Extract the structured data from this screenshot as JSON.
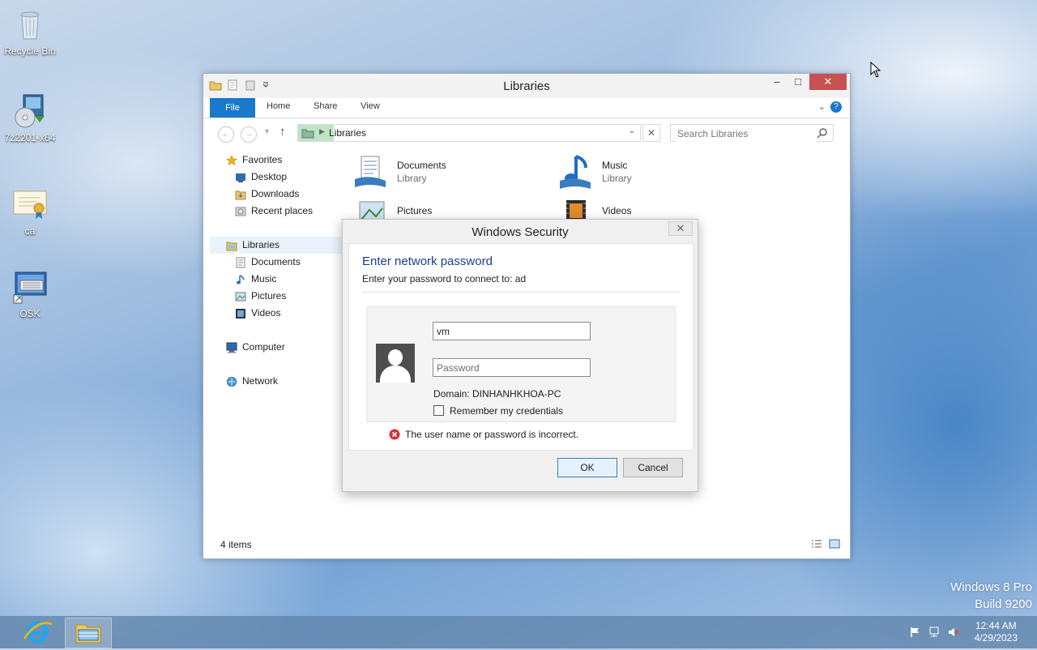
{
  "desktop": {
    "icons": [
      {
        "label": "Recycle Bin"
      },
      {
        "label": "7z2201-x64"
      },
      {
        "label": "ca"
      },
      {
        "label": "OSK"
      }
    ],
    "watermark": {
      "line1": "Windows 8 Pro",
      "line2": "Build 9200"
    }
  },
  "explorer": {
    "title": "Libraries",
    "ribbon_tabs": {
      "file": "File",
      "home": "Home",
      "share": "Share",
      "view": "View"
    },
    "address": "Libraries",
    "search_placeholder": "Search Libraries",
    "nav": {
      "favorites": "Favorites",
      "desktop": "Desktop",
      "downloads": "Downloads",
      "recent": "Recent places",
      "libraries": "Libraries",
      "documents": "Documents",
      "music": "Music",
      "pictures": "Pictures",
      "videos": "Videos",
      "computer": "Computer",
      "network": "Network"
    },
    "items": [
      {
        "name": "Documents",
        "sub": "Library"
      },
      {
        "name": "Music",
        "sub": "Library"
      },
      {
        "name": "Pictures"
      },
      {
        "name": "Videos"
      }
    ],
    "status": "4 items"
  },
  "dialog": {
    "title": "Windows Security",
    "heading": "Enter network password",
    "subheading": "Enter your password to connect to: ad",
    "username_value": "vm",
    "password_placeholder": "Password",
    "domain": "Domain: DINHANHKHOA-PC",
    "remember": "Remember my credentials",
    "error": "The user name or password is incorrect.",
    "ok": "OK",
    "cancel": "Cancel"
  },
  "taskbar": {
    "time": "12:44 AM",
    "date": "4/29/2023"
  },
  "colors": {
    "file_tab": "#1979ca",
    "close_button": "#c75050",
    "heading": "#1c3e8a",
    "error": "#d13438"
  }
}
